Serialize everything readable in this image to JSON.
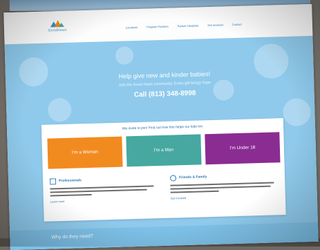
{
  "site": {
    "logo_text": "GoodHeart",
    "brand_color": "#3a8fc4"
  },
  "nav": {
    "items": [
      "Locations",
      "Program Partners",
      "Partner Hospitals",
      "Get Involved",
      "Contact"
    ]
  },
  "hero": {
    "title": "Help give new and kinder babies!",
    "subtitle": "Join the Good Heart community. Every gift brings hope",
    "call": "Call (813) 348-8998",
    "background": "#8fcaec"
  },
  "panel": {
    "heading": "We invite to join! Find out how this helps our kids too",
    "choices": [
      {
        "label": "I'm a Woman",
        "color": "#f28b1f"
      },
      {
        "label": "I'm a Man",
        "color": "#46a8a0"
      },
      {
        "label": "I'm Under 18",
        "color": "#8b2c92"
      }
    ],
    "info": [
      {
        "title": "Professionals",
        "link": "Learn more"
      },
      {
        "title": "Friends & Family",
        "link": "Get involved"
      }
    ]
  },
  "footer_band": {
    "text": "Why do they need?"
  }
}
